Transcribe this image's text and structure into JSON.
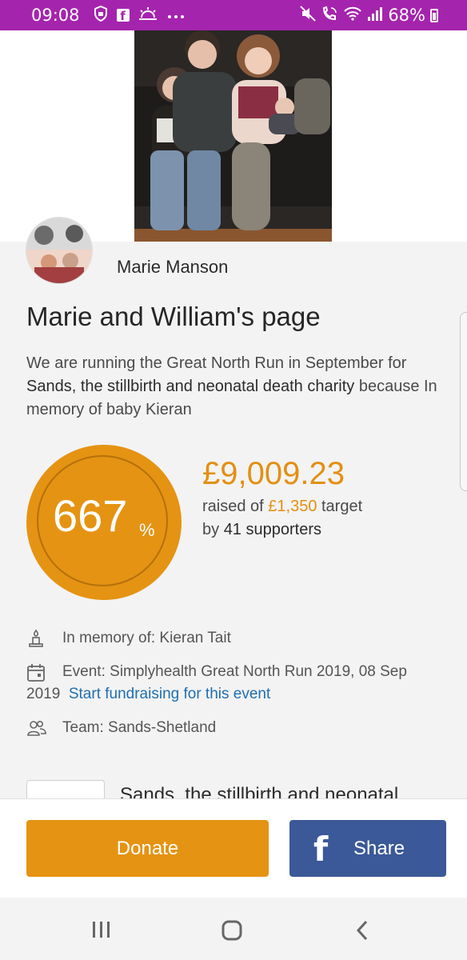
{
  "status_bar": {
    "time": "09:08",
    "left_icons": [
      "shield-icon",
      "facebook-icon",
      "weather-icon",
      "more-dots-icon"
    ],
    "right_icons": [
      "mute-icon",
      "wifi-calling-icon",
      "wifi-icon",
      "signal-icon"
    ],
    "battery": "68%",
    "bar_color": "#a524ad"
  },
  "fundraiser": {
    "owner_name": "Marie Manson",
    "page_title": "Marie and William's page",
    "description_part1": "We are running the Great North Run in September for ",
    "description_charity": "Sands, the stillbirth and neonatal death charity",
    "description_part2": " because In memory of baby Kieran"
  },
  "progress": {
    "percent": "667",
    "percent_sign": "%",
    "raised_amount": "£9,009.23",
    "raised_prefix": "raised of ",
    "target": "£1,350",
    "target_suffix": " target",
    "by_prefix": "by ",
    "supporters_count": "41",
    "supporters_suffix": " supporters",
    "accent_color": "#e59313"
  },
  "details": {
    "memory": "In memory of: Kieran Tait",
    "event": "Event: Simplyhealth Great North Run 2019, 08 Sep 2019",
    "event_link": "Start fundraising for this event",
    "team": "Team: Sands-Shetland"
  },
  "charity": {
    "name": "Sands, the stillbirth and neonatal"
  },
  "actions": {
    "donate_label": "Donate",
    "share_label": "Share",
    "share_icon": "f",
    "share_color": "#3b5998"
  },
  "nav": {
    "icons": [
      "recents-icon",
      "home-icon",
      "back-icon"
    ]
  }
}
